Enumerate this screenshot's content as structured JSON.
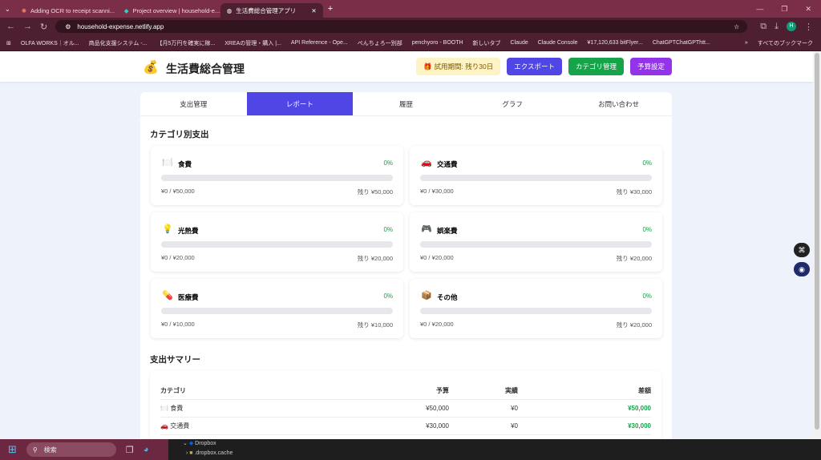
{
  "browser": {
    "tabs": [
      {
        "label": "Adding OCR to receipt scanni..."
      },
      {
        "label": "Project overview | household-e..."
      },
      {
        "label": "生活費総合管理アプリ"
      }
    ],
    "url": "household-expense.netlify.app",
    "bookmarks": [
      "OLFA WORKS｜オル...",
      "商品化支援システム -...",
      "【月5万円を確実に稼...",
      "XREAの管理・購入 |...",
      "API Reference - Ope...",
      "ぺんちょろ一別部",
      "penchyoro - BOOTH",
      "新しいタブ",
      "Claude",
      "Claude Console",
      "¥17,120,633 bitFlyer...",
      "ChatGPTChatGPThtt..."
    ],
    "all_bookmarks": "すべてのブックマーク",
    "profile": "H"
  },
  "header": {
    "title": "生活費総合管理",
    "trial": "試用期間: 残り30日",
    "export": "エクスポート",
    "category_mgmt": "カテゴリ管理",
    "budget": "予算設定"
  },
  "tabs": [
    "支出管理",
    "レポート",
    "履歴",
    "グラフ",
    "お問い合わせ"
  ],
  "category_section": "カテゴリ別支出",
  "categories": [
    {
      "icon": "🍽️",
      "name": "食費",
      "percent": "0%",
      "progress": 0,
      "spent": "¥0 / ¥50,000",
      "remaining": "残り ¥50,000"
    },
    {
      "icon": "🚗",
      "name": "交通費",
      "percent": "0%",
      "progress": 0,
      "spent": "¥0 / ¥30,000",
      "remaining": "残り ¥30,000"
    },
    {
      "icon": "💡",
      "name": "光熱費",
      "percent": "0%",
      "progress": 0,
      "spent": "¥0 / ¥20,000",
      "remaining": "残り ¥20,000"
    },
    {
      "icon": "🎮",
      "name": "娯楽費",
      "percent": "0%",
      "progress": 0,
      "spent": "¥0 / ¥20,000",
      "remaining": "残り ¥20,000"
    },
    {
      "icon": "💊",
      "name": "医療費",
      "percent": "0%",
      "progress": 0,
      "spent": "¥0 / ¥10,000",
      "remaining": "残り ¥10,000"
    },
    {
      "icon": "📦",
      "name": "その他",
      "percent": "0%",
      "progress": 0,
      "spent": "¥0 / ¥20,000",
      "remaining": "残り ¥20,000"
    }
  ],
  "summary": {
    "title": "支出サマリー",
    "headers": [
      "カテゴリ",
      "予算",
      "実績",
      "差額"
    ],
    "rows": [
      {
        "icon": "🍽️",
        "name": "食費",
        "budget": "¥50,000",
        "actual": "¥0",
        "diff": "¥50,000"
      },
      {
        "icon": "🚗",
        "name": "交通費",
        "budget": "¥30,000",
        "actual": "¥0",
        "diff": "¥30,000"
      }
    ]
  },
  "taskbar": {
    "search": "検索",
    "explorer": [
      "Dropbox",
      ".dropbox.cache"
    ]
  }
}
